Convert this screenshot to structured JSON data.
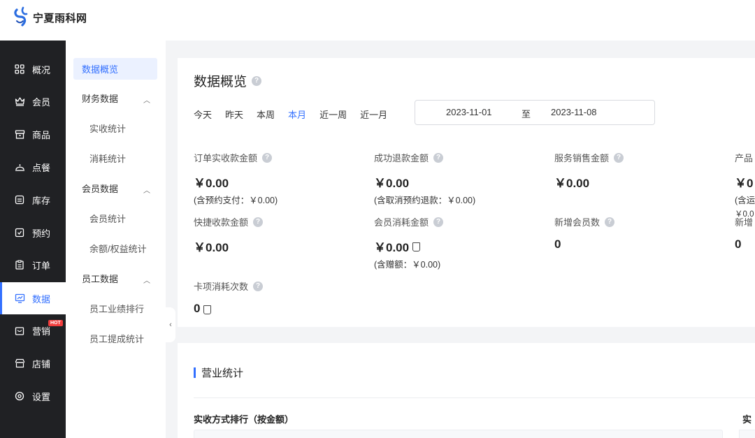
{
  "brand": {
    "name": "宁夏雨科网"
  },
  "colors": {
    "accent": "#3370ff",
    "sidebar_bg": "#202124",
    "hot_badge": "#f23d3d"
  },
  "sidebar": {
    "items": [
      {
        "label": "概况",
        "icon": "grid-icon"
      },
      {
        "label": "会员",
        "icon": "crown-icon"
      },
      {
        "label": "商品",
        "icon": "box-icon"
      },
      {
        "label": "点餐",
        "icon": "cloche-icon"
      },
      {
        "label": "库存",
        "icon": "inventory-icon"
      },
      {
        "label": "预约",
        "icon": "calendar-check-icon"
      },
      {
        "label": "订单",
        "icon": "clipboard-icon"
      },
      {
        "label": "数据",
        "icon": "monitor-chart-icon",
        "active": true
      },
      {
        "label": "营销",
        "icon": "shop-bag-icon",
        "badge": "HOT"
      },
      {
        "label": "店铺",
        "icon": "store-icon"
      },
      {
        "label": "设置",
        "icon": "gear-icon"
      }
    ]
  },
  "subnav": {
    "overview": "数据概览",
    "finance": "财务数据",
    "finance_items": [
      "实收统计",
      "消耗统计"
    ],
    "member": "会员数据",
    "member_items": [
      "会员统计",
      "余额/权益统计"
    ],
    "staff": "员工数据",
    "staff_items": [
      "员工业绩排行",
      "员工提成统计"
    ]
  },
  "overview": {
    "title": "数据概览",
    "ranges": [
      "今天",
      "昨天",
      "本周",
      "本月",
      "近一周",
      "近一月"
    ],
    "active_range": "本月",
    "date_start": "2023-11-01",
    "date_sep": "至",
    "date_end": "2023-11-08",
    "stats": [
      {
        "label": "订单实收款金额",
        "value": "￥0.00",
        "sub": "(含预约支付：￥0.00)"
      },
      {
        "label": "成功退款金额",
        "value": "￥0.00",
        "sub": "(含取消预约退款：￥0.00)"
      },
      {
        "label": "服务销售金额",
        "value": "￥0.00"
      },
      {
        "label": "产品",
        "value": "￥0",
        "sub": "(含运",
        "sub2": "￥0.0"
      },
      {
        "label": "快捷收款金额",
        "value": "￥0.00"
      },
      {
        "label": "会员消耗金额",
        "value": "￥0.00",
        "sub": "(含赠额：￥0.00)"
      },
      {
        "label": "新增会员数",
        "value": "0"
      },
      {
        "label": "新增",
        "value": "0"
      },
      {
        "label": "卡项消耗次数",
        "value": "0"
      }
    ]
  },
  "business": {
    "title": "营业统计",
    "rank_title": "实收方式排行（按金额）",
    "rank_title2": "实"
  }
}
